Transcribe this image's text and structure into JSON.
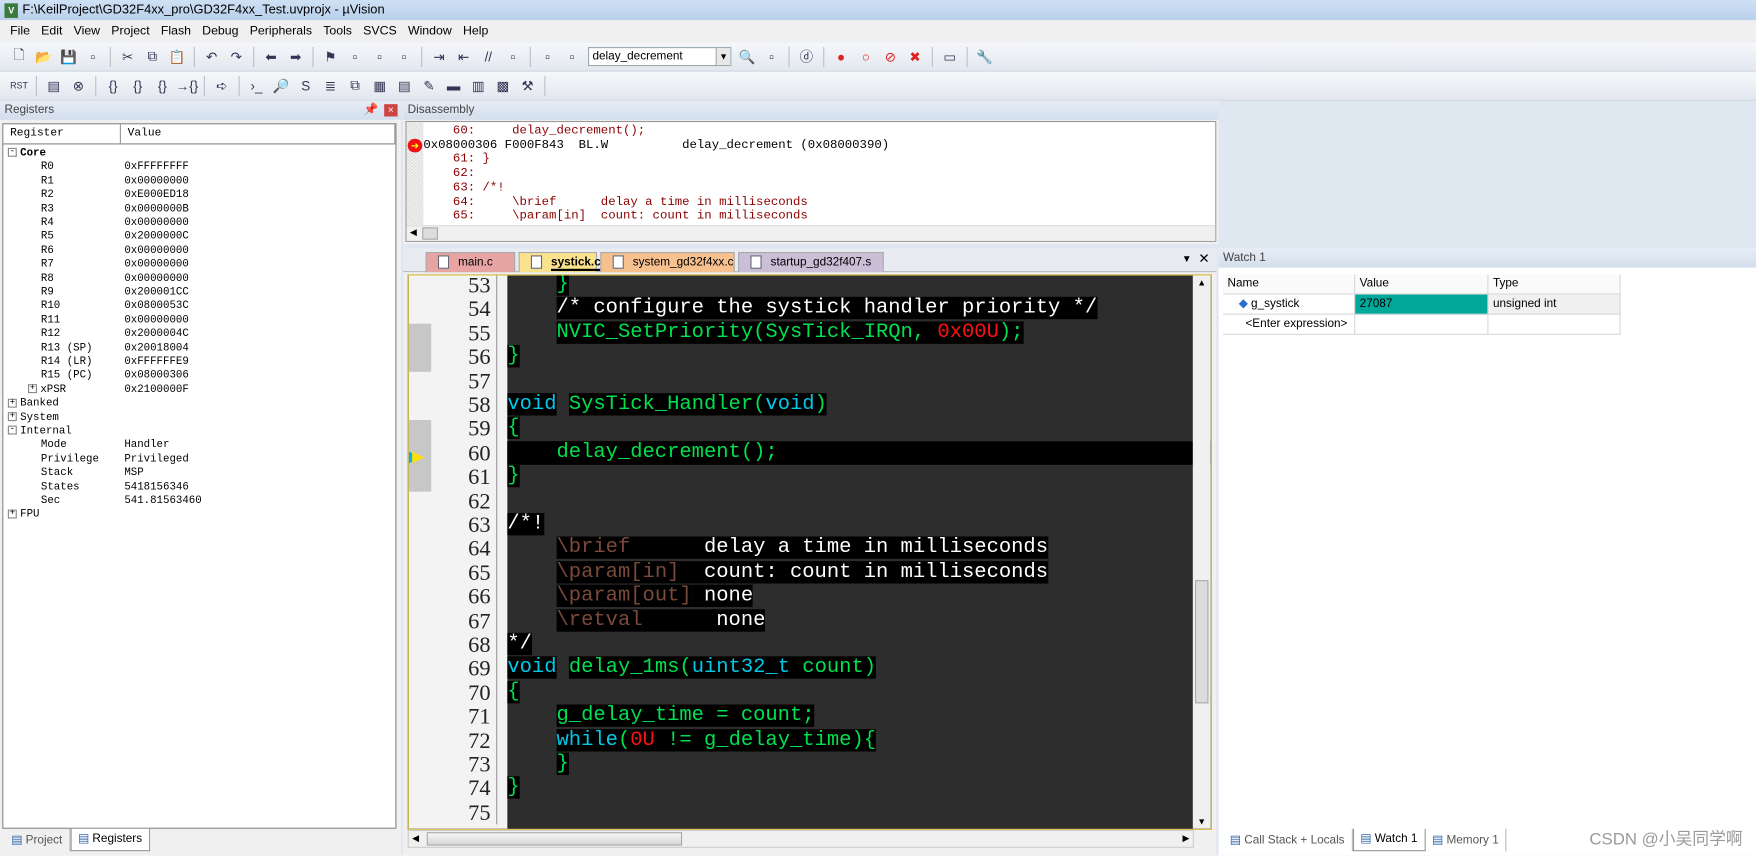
{
  "window": {
    "title": "F:\\KeilProject\\GD32F4xx_pro\\GD32F4xx_Test.uvprojx - µVision",
    "logo": "V"
  },
  "menu": [
    "File",
    "Edit",
    "View",
    "Project",
    "Flash",
    "Debug",
    "Peripherals",
    "Tools",
    "SVCS",
    "Window",
    "Help"
  ],
  "toolbar1": {
    "icons_left": [
      "new-file",
      "open",
      "save",
      "save-all",
      "cut",
      "copy",
      "paste",
      "undo",
      "redo",
      "nav-back",
      "nav-forward",
      "bookmark",
      "bookmark-prev",
      "bookmark-next",
      "bookmark-clear",
      "indent",
      "unindent",
      "comment",
      "uncomment",
      "find-in-files"
    ],
    "function_combo": "delay_decrement",
    "icons_right": [
      "find",
      "incremental-find",
      "debug-session",
      "breakpoint-insert",
      "breakpoint-enable",
      "breakpoint-disable",
      "breakpoint-kill",
      "window-layout",
      "configure"
    ]
  },
  "toolbar2": [
    "reset",
    "run",
    "stop",
    "step-into",
    "step-over",
    "step-out",
    "run-to-cursor",
    "show-next-statement",
    "command-window",
    "disassembly-window",
    "symbols-window",
    "registers-window",
    "call-stack-window",
    "watch-window",
    "memory-window",
    "serial-window",
    "analysis-window",
    "trace-window",
    "system-viewer",
    "toolbox"
  ],
  "registers": {
    "title": "Registers",
    "col_register": "Register",
    "col_value": "Value",
    "rows": [
      {
        "d": 0,
        "exp": "-",
        "name": "Core",
        "value": "",
        "bold": true
      },
      {
        "d": 1,
        "name": "R0",
        "value": "0xFFFFFFFF"
      },
      {
        "d": 1,
        "name": "R1",
        "value": "0x00000000"
      },
      {
        "d": 1,
        "name": "R2",
        "value": "0xE000ED18"
      },
      {
        "d": 1,
        "name": "R3",
        "value": "0x0000000B"
      },
      {
        "d": 1,
        "name": "R4",
        "value": "0x00000000"
      },
      {
        "d": 1,
        "name": "R5",
        "value": "0x2000000C"
      },
      {
        "d": 1,
        "name": "R6",
        "value": "0x00000000"
      },
      {
        "d": 1,
        "name": "R7",
        "value": "0x00000000"
      },
      {
        "d": 1,
        "name": "R8",
        "value": "0x00000000"
      },
      {
        "d": 1,
        "name": "R9",
        "value": "0x200001CC"
      },
      {
        "d": 1,
        "name": "R10",
        "value": "0x0800053C"
      },
      {
        "d": 1,
        "name": "R11",
        "value": "0x00000000"
      },
      {
        "d": 1,
        "name": "R12",
        "value": "0x2000004C"
      },
      {
        "d": 1,
        "name": "R13 (SP)",
        "value": "0x20018004"
      },
      {
        "d": 1,
        "name": "R14 (LR)",
        "value": "0xFFFFFFE9"
      },
      {
        "d": 1,
        "name": "R15 (PC)",
        "value": "0x08000306"
      },
      {
        "d": 1,
        "exp": "+",
        "name": "xPSR",
        "value": "0x2100000F"
      },
      {
        "d": 0,
        "exp": "+",
        "name": "Banked",
        "value": ""
      },
      {
        "d": 0,
        "exp": "+",
        "name": "System",
        "value": ""
      },
      {
        "d": 0,
        "exp": "-",
        "name": "Internal",
        "value": ""
      },
      {
        "d": 1,
        "name": "Mode",
        "value": "Handler"
      },
      {
        "d": 1,
        "name": "Privilege",
        "value": "Privileged"
      },
      {
        "d": 1,
        "name": "Stack",
        "value": "MSP"
      },
      {
        "d": 1,
        "name": "States",
        "value": "5418156346"
      },
      {
        "d": 1,
        "name": "Sec",
        "value": "541.81563460"
      },
      {
        "d": 0,
        "exp": "+",
        "name": "FPU",
        "value": ""
      }
    ]
  },
  "left_tabs": [
    {
      "label": "Project",
      "active": false
    },
    {
      "label": "Registers",
      "active": true
    }
  ],
  "disassembly": {
    "title": "Disassembly",
    "lines": [
      {
        "text": "    60:     delay_decrement();",
        "kind": "src"
      },
      {
        "text": "0x08000306 F000F843  BL.W          delay_decrement (0x08000390)",
        "kind": "asm",
        "current": true
      },
      {
        "text": "    61: }",
        "kind": "src"
      },
      {
        "text": "    62: ",
        "kind": "src"
      },
      {
        "text": "    63: /*!",
        "kind": "src"
      },
      {
        "text": "    64:     \\brief      delay a time in milliseconds",
        "kind": "src"
      },
      {
        "text": "    65:     \\param[in]  count: count in milliseconds",
        "kind": "src"
      }
    ]
  },
  "editor": {
    "tabs": [
      {
        "label": "main.c",
        "color": "#e8a3a3"
      },
      {
        "label": "systick.c",
        "color": "#fbe38e",
        "active": true
      },
      {
        "label": "system_gd32f4xx.c",
        "color": "#f6c08f"
      },
      {
        "label": "startup_gd32f407.s",
        "color": "#cbbfd8"
      }
    ],
    "current_line": 60,
    "colors": {
      "g": "#00e050",
      "w": "#ffffff",
      "c": "#00c8e8",
      "r": "#ff1010",
      "b": "#7a4a3a"
    },
    "lines": [
      {
        "n": 53,
        "t": [
          [
            "    ",
            ""
          ],
          [
            "}",
            "g"
          ]
        ]
      },
      {
        "n": 54,
        "t": [
          [
            "    ",
            ""
          ],
          [
            "/* configure the systick handler priority */",
            "w"
          ]
        ]
      },
      {
        "n": 55,
        "t": [
          [
            "    ",
            ""
          ],
          [
            "NVIC_SetPriority(SysTick_IRQn, ",
            "g"
          ],
          [
            "0x00U",
            "r"
          ],
          [
            ");",
            "g"
          ]
        ]
      },
      {
        "n": 56,
        "t": [
          [
            "}",
            "g"
          ]
        ]
      },
      {
        "n": 57,
        "t": []
      },
      {
        "n": 58,
        "t": [
          [
            "void",
            "c"
          ],
          [
            " ",
            ""
          ],
          [
            "SysTick_Handler(",
            "g"
          ],
          [
            "void",
            "c"
          ],
          [
            ")",
            "g"
          ]
        ]
      },
      {
        "n": 59,
        "t": [
          [
            "{",
            "g"
          ]
        ]
      },
      {
        "n": 60,
        "t": [
          [
            "    delay_decrement();",
            "g"
          ]
        ]
      },
      {
        "n": 61,
        "t": [
          [
            "}",
            "g"
          ]
        ]
      },
      {
        "n": 62,
        "t": []
      },
      {
        "n": 63,
        "t": [
          [
            "/*!",
            "w"
          ]
        ]
      },
      {
        "n": 64,
        "t": [
          [
            "    ",
            ""
          ],
          [
            "\\brief",
            "b"
          ],
          [
            "      delay a time in milliseconds",
            "w"
          ]
        ]
      },
      {
        "n": 65,
        "t": [
          [
            "    ",
            ""
          ],
          [
            "\\param[in]",
            "b"
          ],
          [
            "  count: count in milliseconds",
            "w"
          ]
        ]
      },
      {
        "n": 66,
        "t": [
          [
            "    ",
            ""
          ],
          [
            "\\param[out]",
            "b"
          ],
          [
            " none",
            "w"
          ]
        ]
      },
      {
        "n": 67,
        "t": [
          [
            "    ",
            ""
          ],
          [
            "\\retval",
            "b"
          ],
          [
            "      none",
            "w"
          ]
        ]
      },
      {
        "n": 68,
        "t": [
          [
            "*/",
            "w"
          ]
        ]
      },
      {
        "n": 69,
        "t": [
          [
            "void",
            "c"
          ],
          [
            " ",
            ""
          ],
          [
            "delay_1ms(",
            "g"
          ],
          [
            "uint32_t",
            "c"
          ],
          [
            " count)",
            "g"
          ]
        ]
      },
      {
        "n": 70,
        "t": [
          [
            "{",
            "g"
          ]
        ]
      },
      {
        "n": 71,
        "t": [
          [
            "    ",
            ""
          ],
          [
            "g_delay_time = count;",
            "g"
          ]
        ]
      },
      {
        "n": 72,
        "t": [
          [
            "    ",
            ""
          ],
          [
            "while",
            "c"
          ],
          [
            "(",
            "g"
          ],
          [
            "0U",
            "r"
          ],
          [
            " != g_delay_time){",
            "g"
          ]
        ]
      },
      {
        "n": 73,
        "t": [
          [
            "    ",
            ""
          ],
          [
            "}",
            "g"
          ]
        ]
      },
      {
        "n": 74,
        "t": [
          [
            "}",
            "g"
          ]
        ]
      },
      {
        "n": 75,
        "t": []
      }
    ]
  },
  "watch": {
    "title": "Watch 1",
    "columns": [
      "Name",
      "Value",
      "Type"
    ],
    "rows": [
      {
        "name": "g_systick",
        "value": "27087",
        "type": "unsigned int"
      }
    ],
    "placeholder": "<Enter expression>",
    "value_highlight": "#00a89a"
  },
  "right_tabs": [
    {
      "label": "Call Stack + Locals",
      "active": false
    },
    {
      "label": "Watch 1",
      "active": true
    },
    {
      "label": "Memory 1",
      "active": false
    }
  ],
  "watermark": "CSDN @小吴同学啊"
}
